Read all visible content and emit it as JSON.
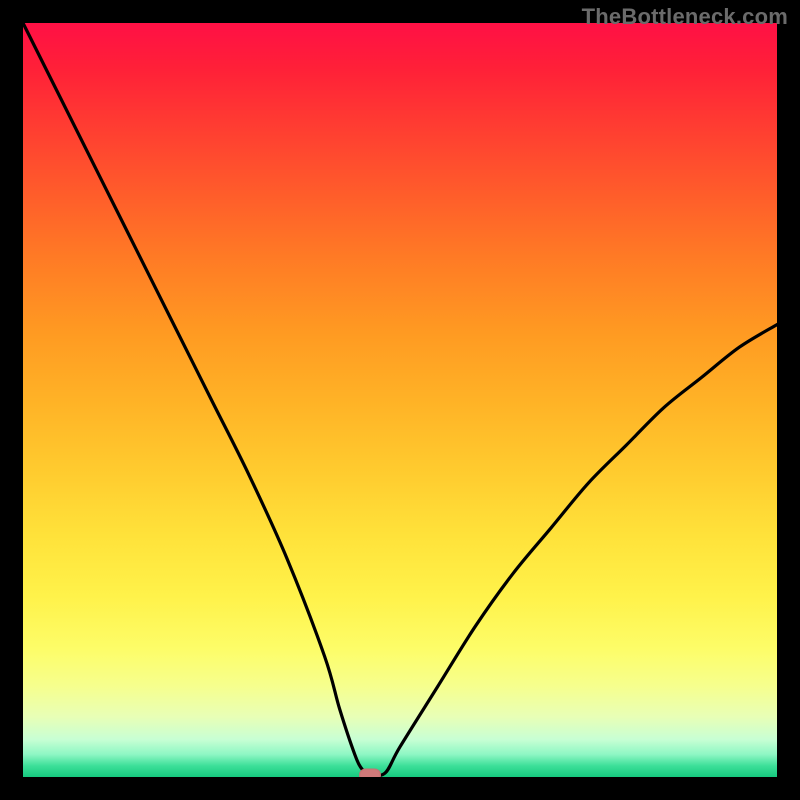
{
  "watermark": "TheBottleneck.com",
  "chart_data": {
    "type": "line",
    "title": "",
    "xlabel": "",
    "ylabel": "",
    "xlim": [
      0,
      100
    ],
    "ylim": [
      0,
      100
    ],
    "series": [
      {
        "name": "bottleneck-curve",
        "x": [
          0,
          5,
          10,
          15,
          20,
          25,
          30,
          35,
          40,
          42,
          44,
          45,
          46,
          48,
          50,
          55,
          60,
          65,
          70,
          75,
          80,
          85,
          90,
          95,
          100
        ],
        "y": [
          100,
          90,
          80,
          70,
          60,
          50,
          40,
          29,
          16,
          9,
          3,
          1,
          0.5,
          0.5,
          4,
          12,
          20,
          27,
          33,
          39,
          44,
          49,
          53,
          57,
          60
        ]
      }
    ],
    "marker": {
      "x": 46,
      "y": 0.3
    },
    "gradient_stops": [
      {
        "offset": 0,
        "color": "#ff1045"
      },
      {
        "offset": 50,
        "color": "#ffca2e"
      },
      {
        "offset": 83,
        "color": "#fdfd68"
      },
      {
        "offset": 100,
        "color": "#16c97f"
      }
    ]
  }
}
